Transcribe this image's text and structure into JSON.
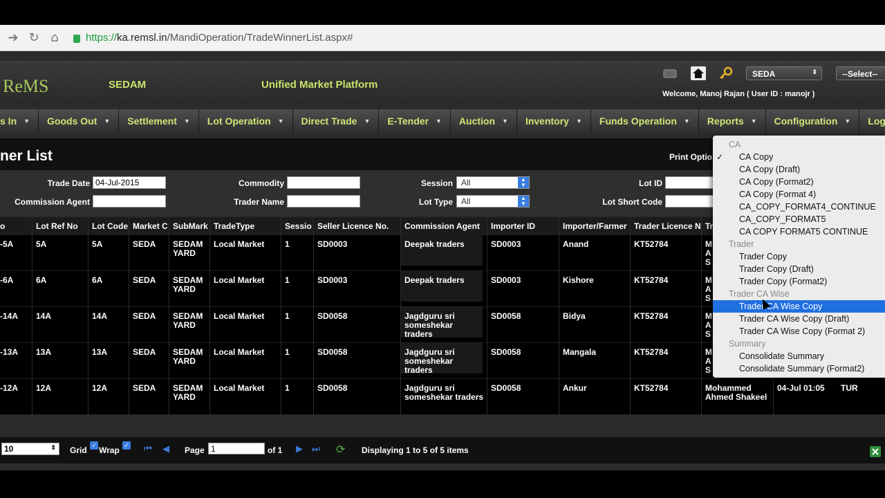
{
  "browser": {
    "url_https": "https://",
    "url_host": "ka.remsl.in",
    "url_path": "/MandiOperation/TradeWinnerList.aspx#"
  },
  "header": {
    "logo": "ReMS",
    "site": "SEDAM",
    "platform": "Unified Market Platform",
    "market_select": "SEDA",
    "other_select": "--Select--",
    "welcome_prefix": "Welcome,",
    "welcome_user": "Manoj Rajan ( User ID : manojr )"
  },
  "menu": [
    "s In",
    "Goods Out",
    "Settlement",
    "Lot Operation",
    "Direct Trade",
    "E-Tender",
    "Auction",
    "Inventory",
    "Funds Operation",
    "Reports",
    "Configuration",
    "Logout"
  ],
  "page": {
    "title": "ner List",
    "print_options": "Print Optio"
  },
  "filters": {
    "trade_date_label": "Trade Date",
    "trade_date_value": "04-Jul-2015",
    "commodity_label": "Commodity",
    "session_label": "Session",
    "session_value": "All",
    "lot_id_label": "Lot ID",
    "commission_agent_label": "Commission Agent",
    "trader_name_label": "Trader Name",
    "lot_type_label": "Lot Type",
    "lot_type_value": "All",
    "lot_short_code_label": "Lot Short Code"
  },
  "table": {
    "headers": [
      "o",
      "Lot Ref No",
      "Lot Code",
      "Market C",
      "SubMark",
      "TradeType",
      "Sessio",
      "Seller Licence No.",
      "Commission Agent",
      "Importer ID",
      "Importer/Farmer",
      "Trader Licence N",
      "Tr"
    ],
    "rows": [
      [
        "-5A",
        "5A",
        "5A",
        "SEDA",
        "SEDAM YARD",
        "Local Market",
        "1",
        "SD0003",
        "Deepak traders",
        "SD0003",
        "Anand",
        "KT52784",
        "M A S",
        "",
        ""
      ],
      [
        "-6A",
        "6A",
        "6A",
        "SEDA",
        "SEDAM YARD",
        "Local Market",
        "1",
        "SD0003",
        "Deepak traders",
        "SD0003",
        "Kishore",
        "KT52784",
        "M A S",
        "",
        ""
      ],
      [
        "-14A",
        "14A",
        "14A",
        "SEDA",
        "SEDAM YARD",
        "Local Market",
        "1",
        "SD0058",
        "Jagdguru sri someshekar traders",
        "SD0058",
        "Bidya",
        "KT52784",
        "M A S",
        "",
        ""
      ],
      [
        "-13A",
        "13A",
        "13A",
        "SEDA",
        "SEDAM YARD",
        "Local Market",
        "1",
        "SD0058",
        "Jagdguru sri someshekar traders",
        "SD0058",
        "Mangala",
        "KT52784",
        "M A S",
        "",
        ""
      ],
      [
        "-12A",
        "12A",
        "12A",
        "SEDA",
        "SEDAM YARD",
        "Local Market",
        "1",
        "SD0058",
        "Jagdguru sri someshekar traders",
        "SD0058",
        "Ankur",
        "KT52784",
        "Mohammed Ahmed Shakeel",
        "04-Jul 01:05",
        "TUR"
      ]
    ]
  },
  "pager": {
    "page_size": "10",
    "grid_label": "Grid",
    "wrap_label": "Wrap",
    "page_label": "Page",
    "page_value": "1",
    "of_label": "of 1",
    "status": "Displaying 1 to 5 of 5 items"
  },
  "dropdown": {
    "groups": [
      {
        "label": "CA",
        "options": [
          "CA Copy",
          "CA Copy (Draft)",
          "CA Copy (Format2)",
          "CA Copy (Format 4)",
          "CA_COPY_FORMAT4_CONTINUE",
          "CA_COPY_FORMAT5",
          "CA COPY FORMAT5 CONTINUE"
        ]
      },
      {
        "label": "Trader",
        "options": [
          "Trader Copy",
          "Trader Copy (Draft)",
          "Trader Copy (Format2)"
        ]
      },
      {
        "label": "Trader CA Wise",
        "options": [
          "Trader CA Wise Copy",
          "Trader CA Wise Copy (Draft)",
          "Trader CA Wise Copy (Format 2)"
        ]
      },
      {
        "label": "Summary",
        "options": [
          "Consolidate Summary",
          "Consolidate Summary (Format2)"
        ]
      }
    ],
    "checked": "CA Copy",
    "highlighted": "Trader CA Wise Copy"
  },
  "colors": {
    "menu_text": "#cde776",
    "brand_green": "#c9e36a",
    "highlight": "#1f6fe0"
  }
}
